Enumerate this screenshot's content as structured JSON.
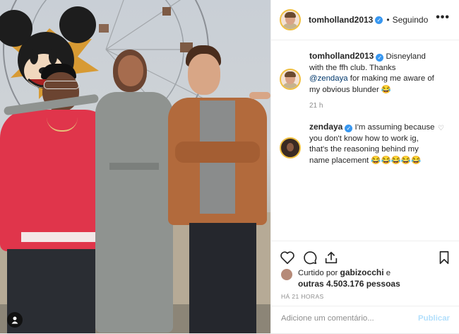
{
  "post": {
    "username": "tomholland2013",
    "follow_status": "Seguindo",
    "more_icon": "•••"
  },
  "caption": {
    "username": "tomholland2013",
    "text_before": " Disneyland with the ffh club. Thanks ",
    "mention": "@zendaya",
    "text_after": " for making me aware of my obvious blunder 😂",
    "timestamp": "21 h"
  },
  "comments": [
    {
      "username": "zendaya",
      "text": " I'm assuming because you don't know how to work ig, that's the reasoning behind my name placement 😂😂😂😂😂"
    }
  ],
  "likes": {
    "prefix": "Curtido por ",
    "user": "gabizocchi",
    "middle": " e",
    "others": "outras 4.503.176 pessoas"
  },
  "date_label": "HÁ 21 HORAS",
  "add_comment": {
    "placeholder": "Adicione um comentário...",
    "publish_label": "Publicar"
  },
  "colors": {
    "verified": "#3897f0",
    "mention": "#00376b",
    "publish_disabled": "#b2dffc",
    "avatar_ring": "#f0c040"
  },
  "icons": [
    "verified-badge-icon",
    "more-options-icon",
    "heart-icon",
    "comment-icon",
    "share-icon",
    "bookmark-icon",
    "person-tag-icon"
  ]
}
